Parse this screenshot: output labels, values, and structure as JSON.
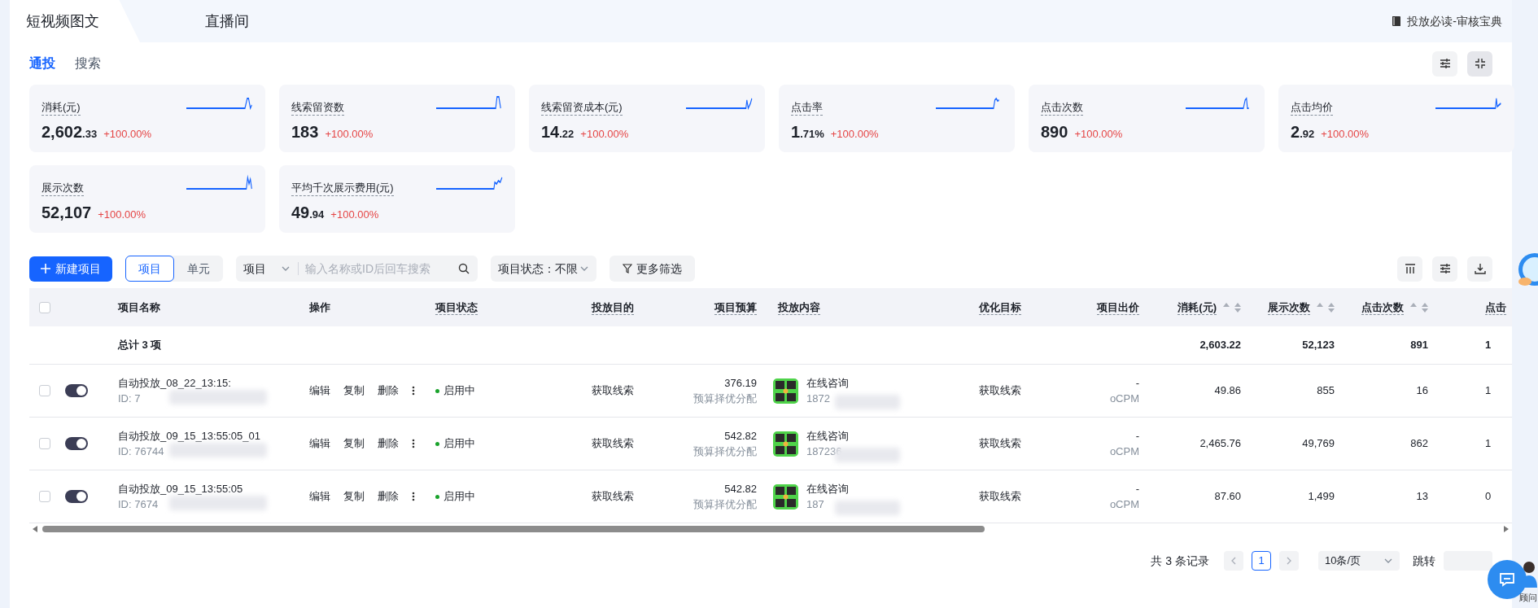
{
  "top_tabs": [
    {
      "label": "短视频图文",
      "selected": true
    },
    {
      "label": "直播间",
      "selected": false
    }
  ],
  "guide_link": "投放必读-审核宝典",
  "sub_tabs": [
    {
      "label": "通投",
      "selected": true
    },
    {
      "label": "搜索",
      "selected": false
    }
  ],
  "metrics": [
    {
      "label": "消耗(元)",
      "value": "2,602",
      "decimal": ".33",
      "change": "+100.00%"
    },
    {
      "label": "线索留资数",
      "value": "183",
      "change": "+100.00%"
    },
    {
      "label": "线索留资成本(元)",
      "value": "14",
      "decimal": ".22",
      "change": "+100.00%"
    },
    {
      "label": "点击率",
      "value": "1",
      "decimal": ".71%",
      "change": "+100.00%"
    },
    {
      "label": "点击次数",
      "value": "890",
      "change": "+100.00%"
    },
    {
      "label": "点击均价",
      "value": "2",
      "decimal": ".92",
      "change": "+100.00%"
    },
    {
      "label": "展示次数",
      "value": "52,107",
      "change": "+100.00%"
    },
    {
      "label": "平均千次展示费用(元)",
      "value": "49",
      "decimal": ".94",
      "change": "+100.00%"
    }
  ],
  "toolbar": {
    "new_button": "新建项目",
    "scope": [
      {
        "label": "项目",
        "selected": true
      },
      {
        "label": "单元",
        "selected": false
      }
    ],
    "search_type": "项目",
    "search_placeholder": "输入名称或ID后回车搜索",
    "status_label": "项目状态：",
    "status_value": "不限",
    "more_filters": "更多筛选"
  },
  "table": {
    "select_all_checked": false,
    "columns": [
      {
        "label": "项目名称",
        "dashed": false,
        "sortable": false
      },
      {
        "label": "操作",
        "dashed": false,
        "sortable": false
      },
      {
        "label": "项目状态",
        "dashed": true,
        "sortable": false
      },
      {
        "label": "投放目的",
        "dashed": true,
        "sortable": false
      },
      {
        "label": "项目预算",
        "dashed": true,
        "sortable": false
      },
      {
        "label": "投放内容",
        "dashed": true,
        "sortable": false
      },
      {
        "label": "优化目标",
        "dashed": true,
        "sortable": false
      },
      {
        "label": "项目出价",
        "dashed": true,
        "sortable": false
      },
      {
        "label": "消耗(元)",
        "dashed": true,
        "sortable": true
      },
      {
        "label": "展示次数",
        "dashed": true,
        "sortable": true
      },
      {
        "label": "点击次数",
        "dashed": true,
        "sortable": true
      },
      {
        "label": "点击",
        "dashed": true,
        "sortable": false
      }
    ],
    "total": {
      "label": "总计 3 项",
      "cost": "2,603.22",
      "impressions": "52,123",
      "clicks": "891",
      "column_12": "1"
    },
    "rows": [
      {
        "checked": false,
        "on": true,
        "name": "自动投放_08_22_13:15:",
        "id": "ID: 7",
        "actions": [
          "编辑",
          "复制",
          "删除"
        ],
        "status": "启用中",
        "purpose": "获取线索",
        "budget": "376.19",
        "budget_mode": "预算择优分配",
        "content_title": "在线咨询",
        "content_id": "1872",
        "target": "获取线索",
        "bid": "-",
        "bid_type": "oCPM",
        "cost": "49.86",
        "impressions": "855",
        "clicks": "16",
        "column_12": "1"
      },
      {
        "checked": false,
        "on": true,
        "name": "自动投放_09_15_13:55:05_01",
        "id": "ID: 76744",
        "actions": [
          "编辑",
          "复制",
          "删除"
        ],
        "status": "启用中",
        "purpose": "获取线索",
        "budget": "542.82",
        "budget_mode": "预算择优分配",
        "content_title": "在线咨询",
        "content_id": "187236",
        "target": "获取线索",
        "bid": "-",
        "bid_type": "oCPM",
        "cost": "2,465.76",
        "impressions": "49,769",
        "clicks": "862",
        "column_12": "1"
      },
      {
        "checked": false,
        "on": true,
        "name": "自动投放_09_15_13:55:05",
        "id": "ID: 7674",
        "actions": [
          "编辑",
          "复制",
          "删除"
        ],
        "status": "启用中",
        "purpose": "获取线索",
        "budget": "542.82",
        "budget_mode": "预算择优分配",
        "content_title": "在线咨询",
        "content_id": "187",
        "target": "获取线索",
        "bid": "-",
        "bid_type": "oCPM",
        "cost": "87.60",
        "impressions": "1,499",
        "clicks": "13",
        "column_12": "0"
      }
    ]
  },
  "pagination": {
    "total": "共 3 条记录",
    "pages": [
      {
        "label": "1",
        "selected": true
      }
    ],
    "page_size": "10条/页",
    "jump": "跳转"
  },
  "advisor": "顾问"
}
